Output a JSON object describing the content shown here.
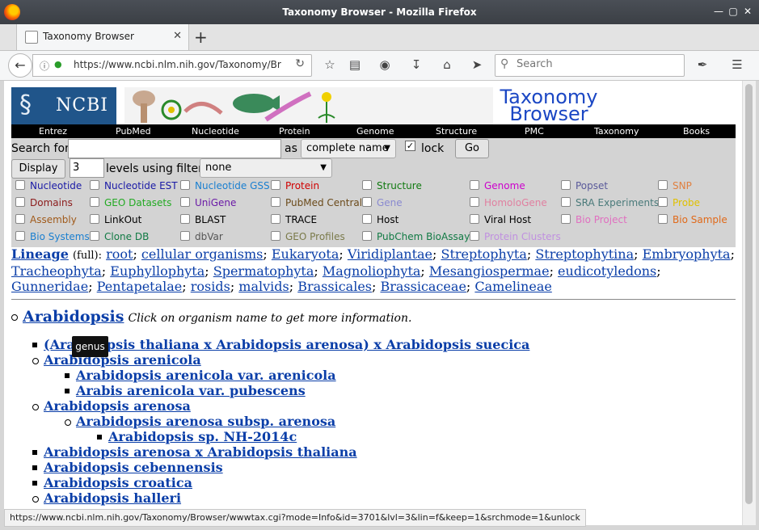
{
  "window": {
    "title": "Taxonomy Browser - Mozilla Firefox"
  },
  "tab": {
    "label": "Taxonomy Browser"
  },
  "nav": {
    "url": "https://www.ncbi.nlm.nih.gov/Taxonomy/Br",
    "search_placeholder": "Search"
  },
  "banner": {
    "logo": "NCBI",
    "title": "Taxonomy Browser"
  },
  "menu": [
    "Entrez",
    "PubMed",
    "Nucleotide",
    "Protein",
    "Genome",
    "Structure",
    "PMC",
    "Taxonomy",
    "Books"
  ],
  "search": {
    "label": "Search for",
    "as_label": "as",
    "mode": "complete name",
    "lock_label": "lock",
    "go": "Go",
    "display": "Display",
    "levels_value": "3",
    "levels_label": "levels using filter:",
    "filter": "none"
  },
  "databases": [
    {
      "name": "Nucleotide",
      "color": "#1a1aa6"
    },
    {
      "name": "Nucleotide EST",
      "color": "#1a1aa6"
    },
    {
      "name": "Nucleotide GSS",
      "color": "#1a7fd0"
    },
    {
      "name": "Protein",
      "color": "#d00000"
    },
    {
      "name": "Structure",
      "color": "#117a11"
    },
    {
      "name": "Genome",
      "color": "#cc00cc"
    },
    {
      "name": "Popset",
      "color": "#5a5a9a"
    },
    {
      "name": "SNP",
      "color": "#e08040"
    },
    {
      "name": "Domains",
      "color": "#8b1a1a"
    },
    {
      "name": "GEO Datasets",
      "color": "#22aa22"
    },
    {
      "name": "UniGene",
      "color": "#6a1aa6"
    },
    {
      "name": "PubMed Central",
      "color": "#6b4a1a"
    },
    {
      "name": "Gene",
      "color": "#8a8ad0"
    },
    {
      "name": "HomoloGene",
      "color": "#e080a0"
    },
    {
      "name": "SRA Experiments",
      "color": "#4a7a7a"
    },
    {
      "name": "Probe",
      "color": "#e0c000"
    },
    {
      "name": "Assembly",
      "color": "#a05a1a"
    },
    {
      "name": "LinkOut",
      "color": "#000000"
    },
    {
      "name": "BLAST",
      "color": "#000000"
    },
    {
      "name": "TRACE",
      "color": "#000000"
    },
    {
      "name": "Host",
      "color": "#000000"
    },
    {
      "name": "Viral Host",
      "color": "#000000"
    },
    {
      "name": "Bio Project",
      "color": "#e070c0"
    },
    {
      "name": "Bio Sample",
      "color": "#e06a1a"
    },
    {
      "name": "Bio Systems",
      "color": "#1a7fd0"
    },
    {
      "name": "Clone DB",
      "color": "#117a44"
    },
    {
      "name": "dbVar",
      "color": "#555555"
    },
    {
      "name": "GEO Profiles",
      "color": "#7a7a4a"
    },
    {
      "name": "PubChem BioAssay",
      "color": "#117a44"
    },
    {
      "name": "Protein Clusters",
      "color": "#c090e0"
    }
  ],
  "lineage": {
    "title": "Lineage",
    "qualifier": "(full):",
    "items": [
      "root",
      "cellular organisms",
      "Eukaryota",
      "Viridiplantae",
      "Streptophyta",
      "Streptophytina",
      "Embryophyta",
      "Tracheophyta",
      "Euphyllophyta",
      "Spermatophyta",
      "Magnoliophyta",
      "Mesangiospermae",
      "eudicotyledons",
      "Gunneridae",
      "Pentapetalae",
      "rosids",
      "malvids",
      "Brassicales",
      "Brassicaceae",
      "Camelineae"
    ]
  },
  "tree": {
    "root": "Arabidopsis",
    "hint": "Click on organism name to get more information.",
    "items": [
      {
        "text": "(Arabidopsis thaliana x Arabidopsis arenosa) x Arabidopsis suecica"
      },
      {
        "text": "Arabidopsis arenicola"
      },
      {
        "text": "Arabidopsis arenicola var. arenicola"
      },
      {
        "text": "Arabis arenicola var. pubescens"
      },
      {
        "text": "Arabidopsis arenosa"
      },
      {
        "text": "Arabidopsis arenosa subsp. arenosa"
      },
      {
        "text": "Arabidopsis sp. NH-2014c"
      },
      {
        "text": "Arabidopsis arenosa x Arabidopsis thaliana"
      },
      {
        "text": "Arabidopsis cebennensis"
      },
      {
        "text": "Arabidopsis croatica"
      },
      {
        "text": "Arabidopsis halleri"
      }
    ]
  },
  "tooltip": "genus",
  "status": "https://www.ncbi.nlm.nih.gov/Taxonomy/Browser/wwwtax.cgi?mode=Info&id=3701&lvl=3&lin=f&keep=1&srchmode=1&unlock"
}
